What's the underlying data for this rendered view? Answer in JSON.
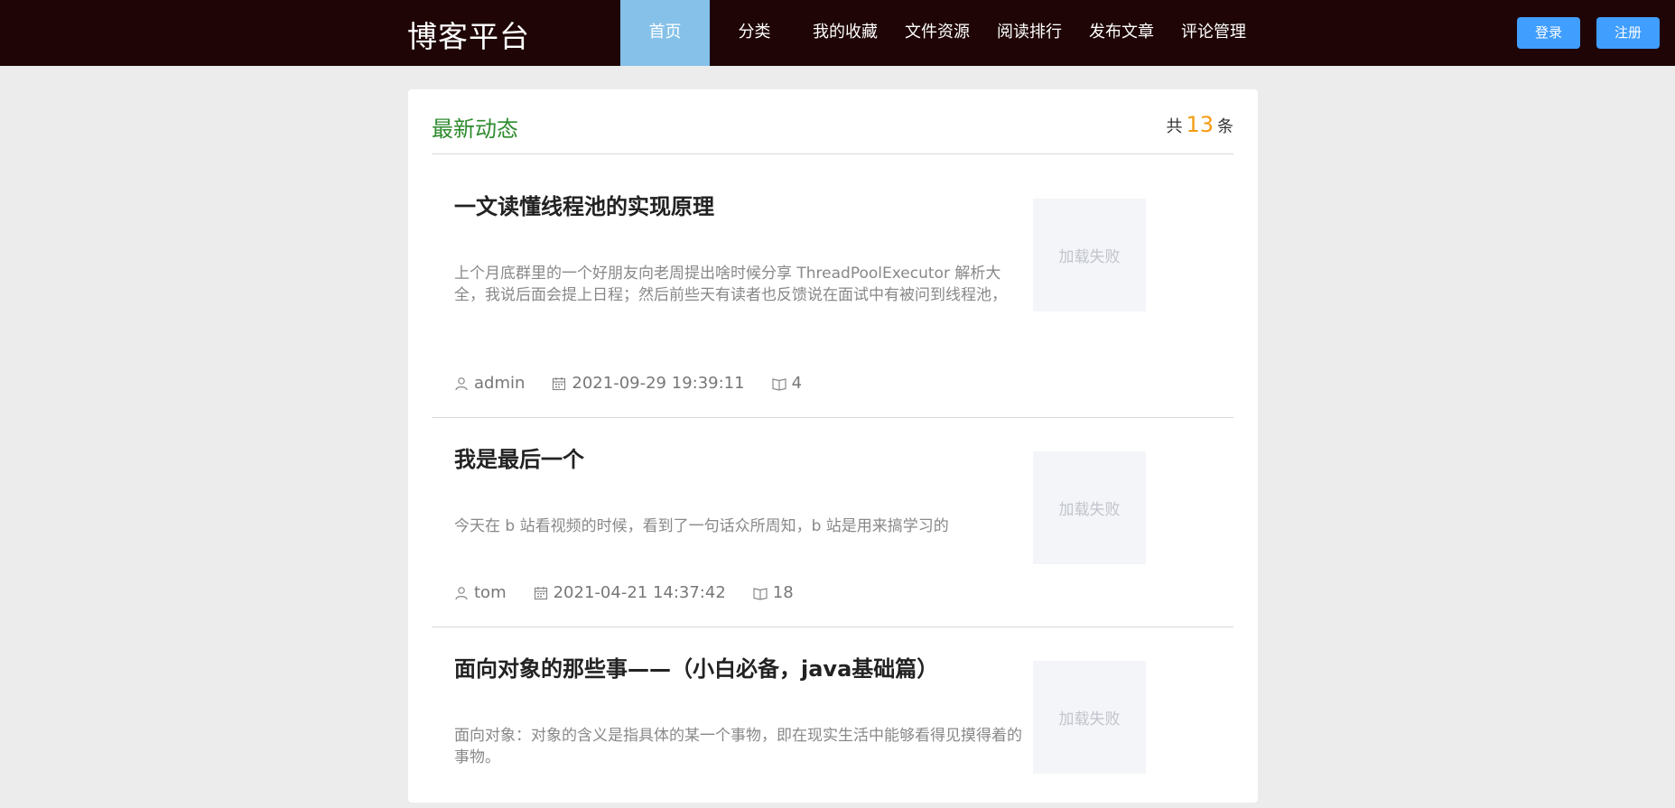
{
  "header": {
    "brand": "博客平台",
    "nav": [
      {
        "label": "首页",
        "active": true
      },
      {
        "label": "分类",
        "active": false
      },
      {
        "label": "我的收藏",
        "active": false
      },
      {
        "label": "文件资源",
        "active": false
      },
      {
        "label": "阅读排行",
        "active": false
      },
      {
        "label": "发布文章",
        "active": false
      },
      {
        "label": "评论管理",
        "active": false
      }
    ],
    "login_label": "登录",
    "register_label": "注册"
  },
  "feed": {
    "title": "最新动态",
    "count_prefix": "共",
    "count": "13",
    "count_suffix": "条",
    "articles": [
      {
        "title": "一文读懂线程池的实现原理",
        "summary": "上个月底群里的一个好朋友向老周提出啥时候分享 ThreadPoolExecutor 解析大全，我说后面会提上日程；然后前些天有读者也反馈说在面试中有被问到线程池，",
        "author": "admin",
        "date": "2021-09-29 19:39:11",
        "reads": "4",
        "thumb_text": "加载失败"
      },
      {
        "title": "我是最后一个",
        "summary": "今天在 b 站看视频的时候，看到了一句话众所周知，b 站是用来搞学习的",
        "author": "tom",
        "date": "2021-04-21 14:37:42",
        "reads": "18",
        "thumb_text": "加载失败"
      },
      {
        "title": "面向对象的那些事——（小白必备，java基础篇）",
        "summary": "面向对象：对象的含义是指具体的某一个事物，即在现实生活中能够看得见摸得着的事物。",
        "author": "",
        "date": "",
        "reads": "",
        "thumb_text": "加载失败"
      }
    ]
  },
  "colors": {
    "topbar": "#1f0505",
    "nav_active": "#85c1e9",
    "button": "#409eff",
    "feed_title": "#2e8b2e",
    "count": "#f39c12"
  },
  "icons": {
    "author": "user-icon",
    "date": "calendar-icon",
    "reads": "book-icon"
  }
}
